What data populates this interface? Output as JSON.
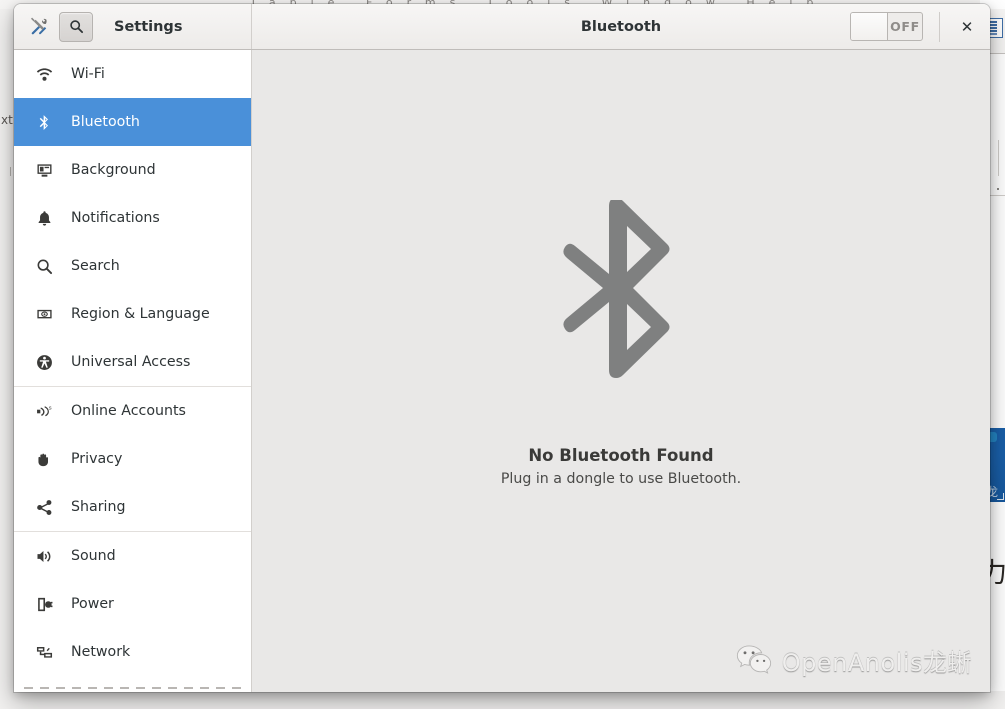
{
  "background": {
    "menubar_text": "Table Forms Tools Window Help",
    "left_text": "xt",
    "right_cjk": "力"
  },
  "header": {
    "tools_icon": "tools-icon",
    "search_icon": "search-icon",
    "left_title": "Settings",
    "right_title": "Bluetooth",
    "toggle": {
      "state_label": "OFF",
      "is_on": false
    },
    "close_icon": "✕"
  },
  "sidebar": {
    "groups": [
      {
        "items": [
          {
            "label": "Wi-Fi",
            "icon": "wifi-icon",
            "selected": false
          },
          {
            "label": "Bluetooth",
            "icon": "bluetooth-icon",
            "selected": true
          },
          {
            "label": "Background",
            "icon": "background-icon",
            "selected": false
          },
          {
            "label": "Notifications",
            "icon": "bell-icon",
            "selected": false
          },
          {
            "label": "Search",
            "icon": "search-icon",
            "selected": false
          },
          {
            "label": "Region & Language",
            "icon": "flag-icon",
            "selected": false
          },
          {
            "label": "Universal Access",
            "icon": "accessibility-icon",
            "selected": false
          }
        ]
      },
      {
        "items": [
          {
            "label": "Online Accounts",
            "icon": "online-accounts-icon",
            "selected": false
          },
          {
            "label": "Privacy",
            "icon": "hand-icon",
            "selected": false
          },
          {
            "label": "Sharing",
            "icon": "share-icon",
            "selected": false
          }
        ]
      },
      {
        "items": [
          {
            "label": "Sound",
            "icon": "speaker-icon",
            "selected": false
          },
          {
            "label": "Power",
            "icon": "power-icon",
            "selected": false
          },
          {
            "label": "Network",
            "icon": "network-icon",
            "selected": false
          }
        ]
      }
    ]
  },
  "main": {
    "illustration": "bluetooth-large-icon",
    "title": "No Bluetooth Found",
    "subtitle": "Plug in a dongle to use Bluetooth."
  },
  "watermark": {
    "icon": "wechat-icon",
    "text": "OpenAnolis龙蜥"
  },
  "colors": {
    "accent": "#4a90d9",
    "content_bg": "#e9e8e7",
    "glyph_gray": "#7f8080",
    "titlebar_bg": "#edebe9"
  }
}
